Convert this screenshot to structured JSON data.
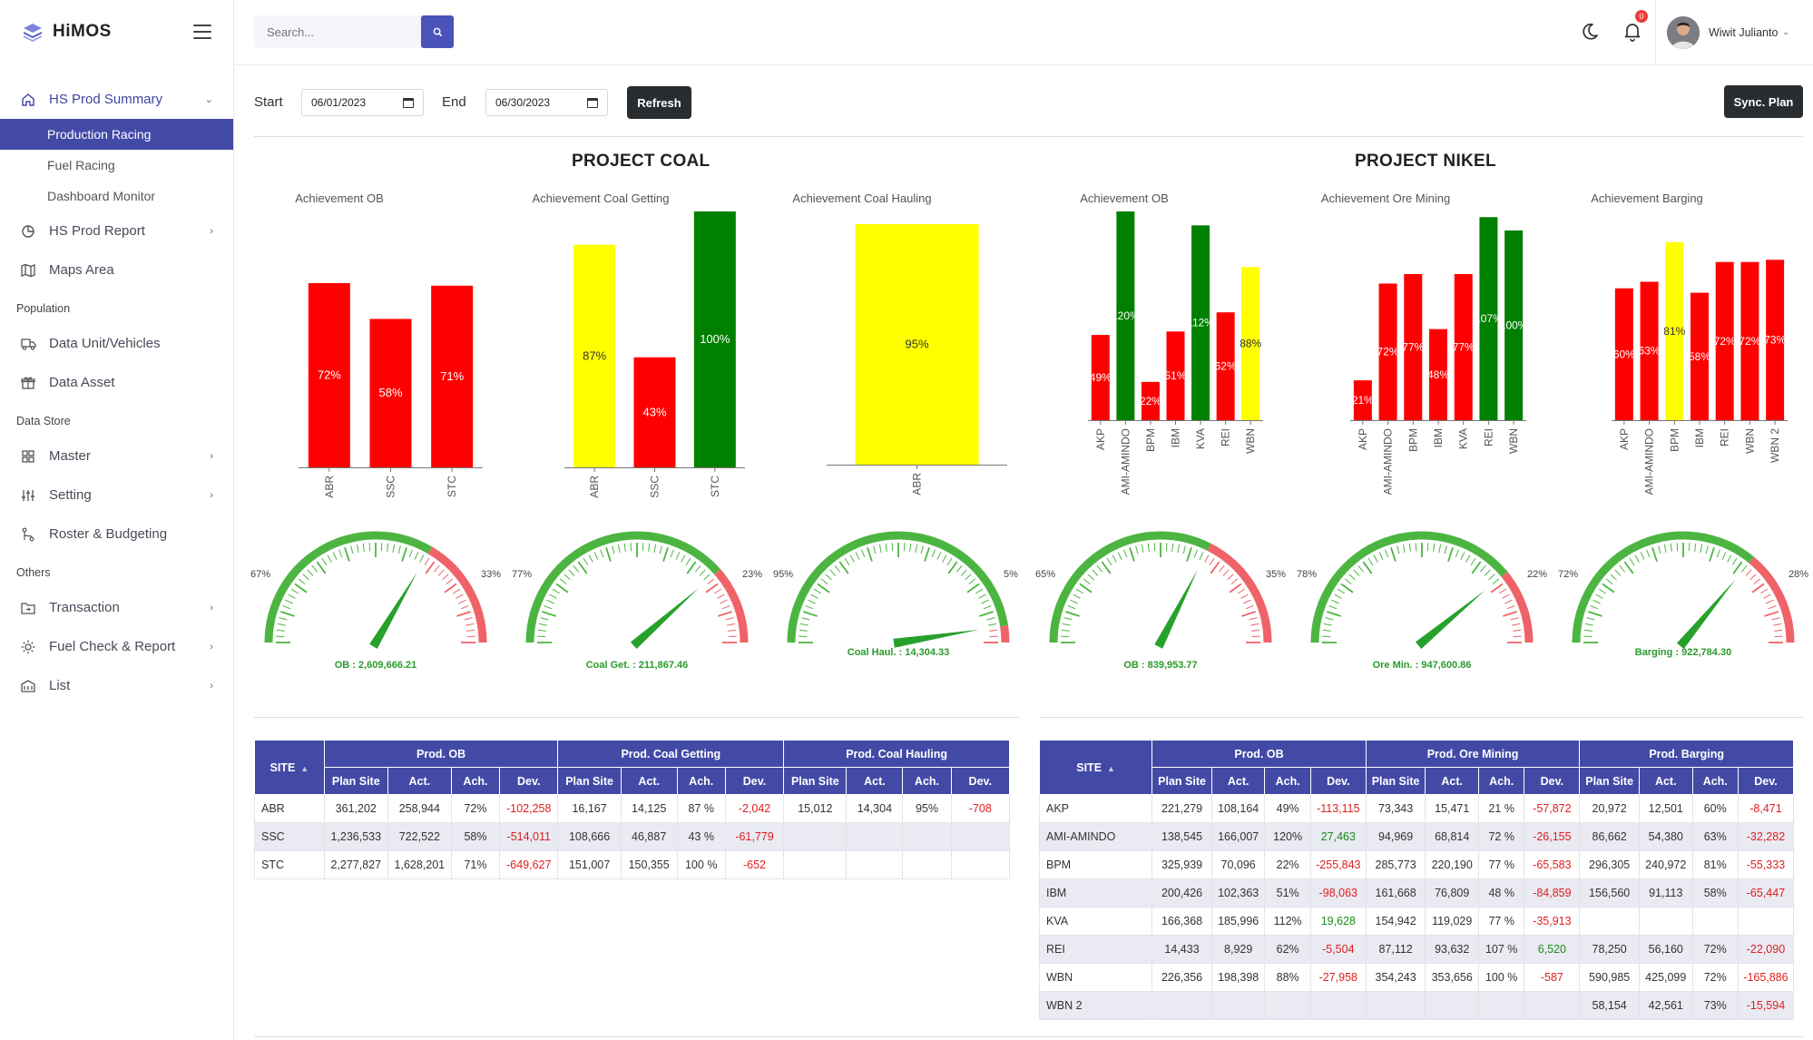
{
  "app": {
    "name": "HiMOS"
  },
  "sidebar": {
    "summary": {
      "label": "HS Prod Summary",
      "subs": [
        "Production Racing",
        "Fuel Racing",
        "Dashboard Monitor"
      ]
    },
    "report": "HS Prod Report",
    "maps": "Maps Area",
    "sec_population": "Population",
    "units": "Data Unit/Vehicles",
    "asset": "Data Asset",
    "sec_store": "Data Store",
    "master": "Master",
    "setting": "Setting",
    "roster": "Roster & Budgeting",
    "sec_others": "Others",
    "transaction": "Transaction",
    "fuel": "Fuel Check & Report",
    "list": "List"
  },
  "topbar": {
    "search_placeholder": "Search...",
    "notif_count": "0",
    "user_name": "Wiwit Julianto"
  },
  "filters": {
    "start_label": "Start",
    "start_value": "06/01/2023",
    "end_label": "End",
    "end_value": "06/30/2023",
    "refresh": "Refresh",
    "sync": "Sync. Plan"
  },
  "projects": {
    "coal": "PROJECT COAL",
    "nikel": "PROJECT NIKEL"
  },
  "chart_titles": [
    "Achievement OB",
    "Achievement  Coal Getting",
    "Achievement Coal Hauling",
    "Achievement OB",
    "Achievement  Ore Mining",
    "Achievement Barging"
  ],
  "colors": {
    "red": "#ff0000",
    "yellow": "#ffff00",
    "green": "#008000",
    "gauge_green": "#4cb541",
    "gauge_red": "#ef6368",
    "header": "#434aa6"
  },
  "chart_data": [
    {
      "type": "bar",
      "title": "Achievement OB",
      "categories": [
        "ABR",
        "SSC",
        "STC"
      ],
      "values": [
        72,
        58,
        71
      ],
      "labels": [
        "72%",
        "58%",
        "71%"
      ],
      "colors": [
        "red",
        "red",
        "red"
      ]
    },
    {
      "type": "bar",
      "title": "Achievement  Coal Getting",
      "categories": [
        "ABR",
        "SSC",
        "STC"
      ],
      "values": [
        87,
        43,
        100
      ],
      "labels": [
        "87%",
        "43%",
        "100%"
      ],
      "colors": [
        "yellow",
        "red",
        "green"
      ]
    },
    {
      "type": "bar",
      "title": "Achievement Coal Hauling",
      "categories": [
        "ABR"
      ],
      "values": [
        95
      ],
      "labels": [
        "95%"
      ],
      "colors": [
        "yellow"
      ]
    },
    {
      "type": "bar",
      "title": "Achievement OB",
      "categories": [
        "AKP",
        "AMI-AMINDO",
        "BPM",
        "IBM",
        "KVA",
        "REI",
        "WBN"
      ],
      "values": [
        49,
        120,
        22,
        51,
        112,
        62,
        88
      ],
      "labels": [
        "49%",
        "120%",
        "22%",
        "51%",
        "112%",
        "62%",
        "88%"
      ],
      "colors": [
        "red",
        "green",
        "red",
        "red",
        "green",
        "red",
        "yellow"
      ]
    },
    {
      "type": "bar",
      "title": "Achievement  Ore Mining",
      "categories": [
        "AKP",
        "AMI-AMINDO",
        "BPM",
        "IBM",
        "KVA",
        "REI",
        "WBN"
      ],
      "values": [
        21,
        72,
        77,
        48,
        77,
        107,
        100
      ],
      "labels": [
        "21%",
        "72%",
        "77%",
        "48%",
        "77%",
        "107%",
        "100%"
      ],
      "colors": [
        "red",
        "red",
        "red",
        "red",
        "red",
        "green",
        "green"
      ]
    },
    {
      "type": "bar",
      "title": "Achievement Barging",
      "categories": [
        "AKP",
        "AMI-AMINDO",
        "BPM",
        "IBM",
        "REI",
        "WBN",
        "WBN 2"
      ],
      "values": [
        60,
        63,
        81,
        58,
        72,
        72,
        73
      ],
      "labels": [
        "60%",
        "63%",
        "81%",
        "58%",
        "72%",
        "72%",
        "73%"
      ],
      "colors": [
        "red",
        "red",
        "yellow",
        "red",
        "red",
        "red",
        "red"
      ]
    }
  ],
  "gauges": [
    {
      "value": 67,
      "left_label": "67%",
      "right_label": "33%",
      "caption": "OB : 2,609,666.21"
    },
    {
      "value": 77,
      "left_label": "77%",
      "right_label": "23%",
      "caption": "Coal Get. : 211,867.46"
    },
    {
      "value": 95,
      "left_label": "95%",
      "right_label": "5%",
      "caption": "Coal Haul. : 14,304.33"
    },
    {
      "value": 65,
      "left_label": "65%",
      "right_label": "35%",
      "caption": "OB : 839,953.77"
    },
    {
      "value": 78,
      "left_label": "78%",
      "right_label": "22%",
      "caption": "Ore Min. : 947,600.86"
    },
    {
      "value": 72,
      "left_label": "72%",
      "right_label": "28%",
      "caption": "Barging : 922,784.30"
    }
  ],
  "coal_table": {
    "site_header": "SITE",
    "groups": [
      "Prod. OB",
      "Prod. Coal Getting",
      "Prod. Coal Hauling"
    ],
    "sub_headers": [
      "Plan Site",
      "Act.",
      "Ach.",
      "Dev."
    ],
    "rows": [
      [
        "ABR",
        "361,202",
        "258,944",
        "72%",
        "-102,258",
        "16,167",
        "14,125",
        "87 %",
        "-2,042",
        "15,012",
        "14,304",
        "95%",
        "-708"
      ],
      [
        "SSC",
        "1,236,533",
        "722,522",
        "58%",
        "-514,011",
        "108,666",
        "46,887",
        "43 %",
        "-61,779",
        "",
        "",
        "",
        ""
      ],
      [
        "STC",
        "2,277,827",
        "1,628,201",
        "71%",
        "-649,627",
        "151,007",
        "150,355",
        "100 %",
        "-652",
        "",
        "",
        "",
        ""
      ]
    ]
  },
  "nikel_table": {
    "site_header": "SITE",
    "groups": [
      "Prod. OB",
      "Prod. Ore Mining",
      "Prod. Barging"
    ],
    "sub_headers": [
      "Plan Site",
      "Act.",
      "Ach.",
      "Dev."
    ],
    "rows": [
      [
        "AKP",
        "221,279",
        "108,164",
        "49%",
        "-113,115",
        "73,343",
        "15,471",
        "21 %",
        "-57,872",
        "20,972",
        "12,501",
        "60%",
        "-8,471"
      ],
      [
        "AMI-AMINDO",
        "138,545",
        "166,007",
        "120%",
        "27,463",
        "94,969",
        "68,814",
        "72 %",
        "-26,155",
        "86,662",
        "54,380",
        "63%",
        "-32,282"
      ],
      [
        "BPM",
        "325,939",
        "70,096",
        "22%",
        "-255,843",
        "285,773",
        "220,190",
        "77 %",
        "-65,583",
        "296,305",
        "240,972",
        "81%",
        "-55,333"
      ],
      [
        "IBM",
        "200,426",
        "102,363",
        "51%",
        "-98,063",
        "161,668",
        "76,809",
        "48 %",
        "-84,859",
        "156,560",
        "91,113",
        "58%",
        "-65,447"
      ],
      [
        "KVA",
        "166,368",
        "185,996",
        "112%",
        "19,628",
        "154,942",
        "119,029",
        "77 %",
        "-35,913",
        "",
        "",
        "",
        ""
      ],
      [
        "REI",
        "14,433",
        "8,929",
        "62%",
        "-5,504",
        "87,112",
        "93,632",
        "107 %",
        "6,520",
        "78,250",
        "56,160",
        "72%",
        "-22,090"
      ],
      [
        "WBN",
        "226,356",
        "198,398",
        "88%",
        "-27,958",
        "354,243",
        "353,656",
        "100 %",
        "-587",
        "590,985",
        "425,099",
        "72%",
        "-165,886"
      ],
      [
        "WBN 2",
        "",
        "",
        "",
        "",
        "",
        "",
        "",
        "",
        "58,154",
        "42,561",
        "73%",
        "-15,594"
      ]
    ]
  }
}
